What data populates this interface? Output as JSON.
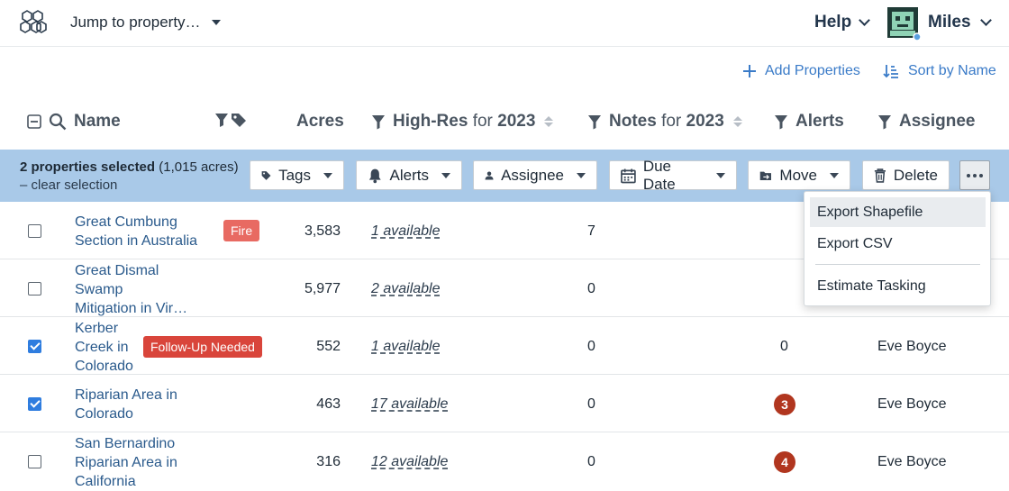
{
  "header": {
    "jump_label": "Jump to property…",
    "help_label": "Help",
    "user_name": "Miles"
  },
  "actions": {
    "add_properties": "Add Properties",
    "sort_by_name": "Sort by Name"
  },
  "columns": {
    "name": "Name",
    "acres": "Acres",
    "highres_prefix": "High-Res",
    "highres_for": "for",
    "highres_year": "2023",
    "notes_prefix": "Notes",
    "notes_for": "for",
    "notes_year": "2023",
    "alerts": "Alerts",
    "assignee": "Assignee"
  },
  "selection": {
    "count_text": "2 properties selected",
    "acres_text": "(1,015 acres)",
    "clear_text": "– clear selection",
    "buttons": {
      "tags": "Tags",
      "alerts": "Alerts",
      "assignee": "Assignee",
      "due_date": "Due Date",
      "move": "Move",
      "delete": "Delete"
    }
  },
  "rows": [
    {
      "name": "Great Cumbung Section in Australia",
      "name_lines": [
        "Great Cumbung",
        "Section in Australia"
      ],
      "tag": "Fire",
      "acres": "3,583",
      "highres": "1 available",
      "notes": "7",
      "alerts": "",
      "assignee": "",
      "checked": false
    },
    {
      "name": "Great Dismal Swamp Mitigation in Vir…",
      "name_lines": [
        "Great Dismal",
        "Swamp",
        "Mitigation in Vir…"
      ],
      "tag": "",
      "acres": "5,977",
      "highres": "2 available",
      "notes": "0",
      "alerts": "",
      "assignee": "",
      "checked": false
    },
    {
      "name": "Kerber Creek in Colorado",
      "name_lines": [
        "Kerber",
        "Creek in",
        "Colorado"
      ],
      "tag": "Follow-Up Needed",
      "acres": "552",
      "highres": "1 available",
      "notes": "0",
      "alerts": "0",
      "assignee": "Eve Boyce",
      "checked": true
    },
    {
      "name": "Riparian Area in Colorado",
      "name_lines": [
        "Riparian Area in",
        "Colorado"
      ],
      "tag": "",
      "acres": "463",
      "highres": "17 available",
      "notes": "0",
      "alerts": "3",
      "assignee": "Eve Boyce",
      "checked": true
    },
    {
      "name": "San Bernardino Riparian Area in California",
      "name_lines": [
        "San Bernardino",
        "Riparian Area in",
        "California"
      ],
      "tag": "",
      "acres": "316",
      "highres": "12 available",
      "notes": "0",
      "alerts": "4",
      "assignee": "Eve Boyce",
      "checked": false
    }
  ],
  "menu": {
    "export_shapefile": "Export Shapefile",
    "export_csv": "Export CSV",
    "estimate_tasking": "Estimate Tasking"
  },
  "colors": {
    "accent": "#3a7bc8",
    "selection_bar": "#a9c9e8",
    "tag_fire": "#e86a62",
    "tag_followup": "#d9453b",
    "alert_badge": "#b1361f",
    "checkbox": "#2f7ddf"
  }
}
